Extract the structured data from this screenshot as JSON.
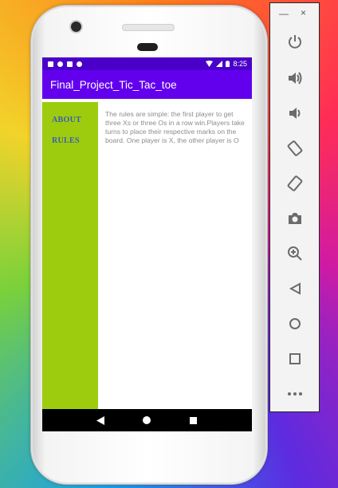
{
  "status_bar": {
    "time": "8:25"
  },
  "app_bar": {
    "title": "Final_Project_Tic_Tac_toe"
  },
  "sidebar": {
    "items": [
      {
        "label": "ABOUT"
      },
      {
        "label": "RULES"
      }
    ]
  },
  "main": {
    "rules_text": "The rules are simple: the first player to get three Xs or three Os in a row win.Players take turns to place their respective marks on the board. One player is X, the other player is O"
  },
  "emulator_panel": {
    "minimize_label": "—",
    "close_label": "×",
    "controls": [
      "power-icon",
      "volume-up-icon",
      "volume-down-icon",
      "rotate-left-icon",
      "rotate-right-icon",
      "camera-icon",
      "zoom-icon",
      "back-icon",
      "home-icon",
      "overview-icon",
      "more-icon"
    ]
  },
  "colors": {
    "status_bar": "#4a00c8",
    "app_bar": "#6200ee",
    "sidebar": "#9ccc0d",
    "sidebar_text": "#3d5bbd",
    "body_text": "#8c8c8c"
  }
}
